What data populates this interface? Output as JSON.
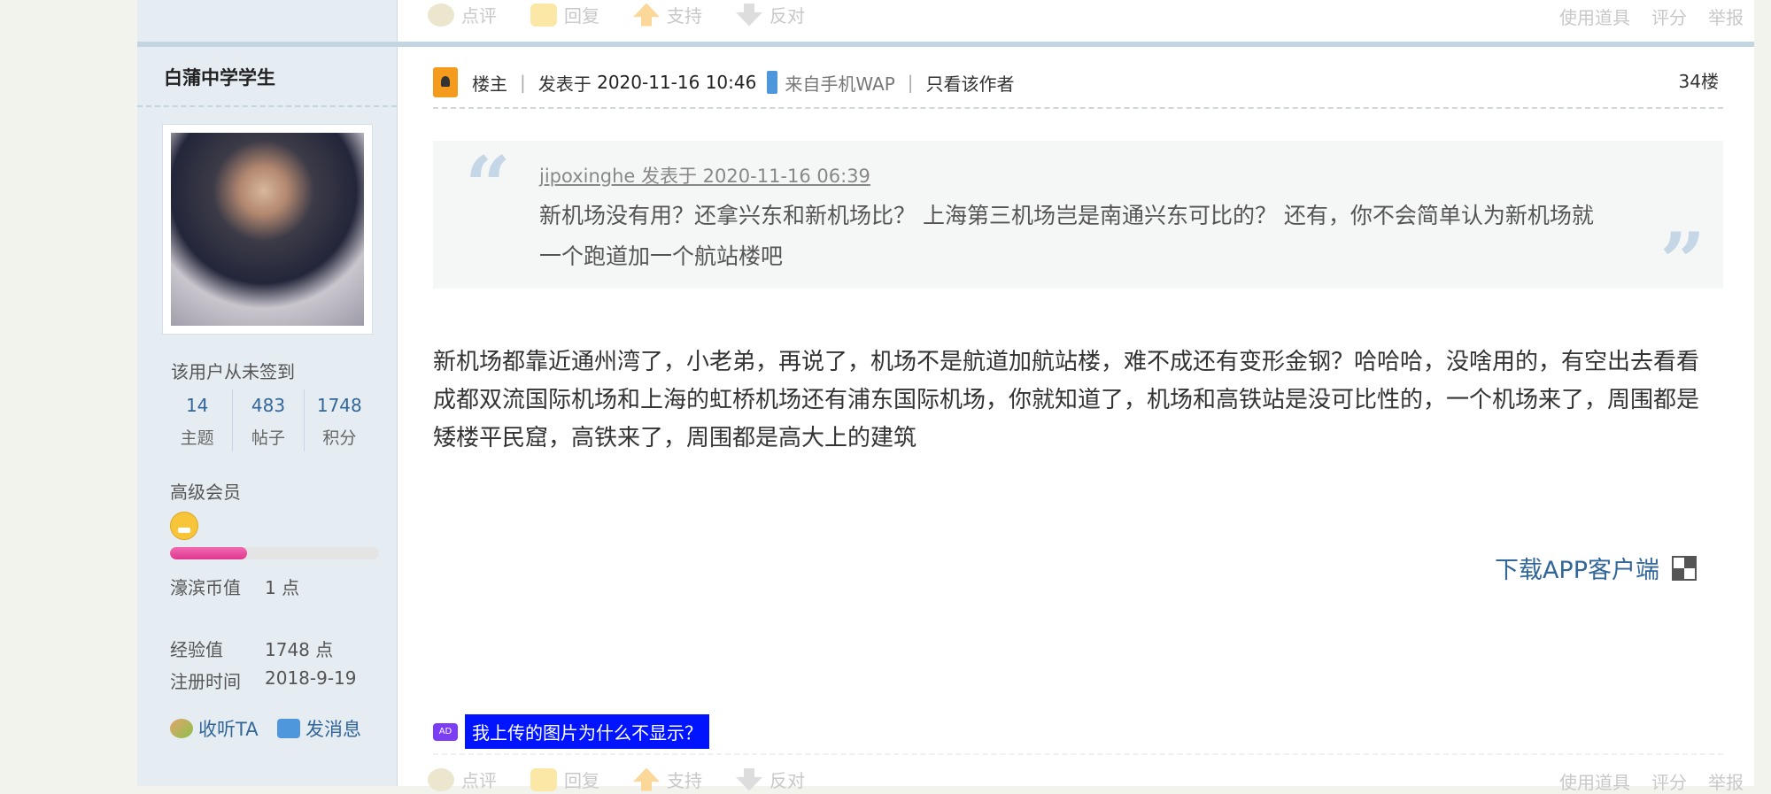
{
  "top_actions": {
    "comment": "点评",
    "reply": "回复",
    "support": "支持",
    "oppose": "反对",
    "tools": "使用道具",
    "rate": "评分",
    "report": "举报"
  },
  "user": {
    "name": "白蒲中学学生",
    "checkin": "该用户从未签到",
    "stats": [
      {
        "num": "14",
        "label": "主题"
      },
      {
        "num": "483",
        "label": "帖子"
      },
      {
        "num": "1748",
        "label": "积分"
      }
    ],
    "level": "高级会员",
    "level_progress": 0.37,
    "coin_label": "濠滨币值",
    "coin_value": "1 点",
    "exp_label": "经验值",
    "exp_value": "1748 点",
    "reg_label": "注册时间",
    "reg_value": "2018-9-19",
    "follow": "收听TA",
    "message": "发消息"
  },
  "post": {
    "owner": "楼主",
    "posted_prefix": "发表于",
    "posted_time": "2020-11-16 10:46",
    "source": "来自手机WAP",
    "only_author": "只看该作者",
    "floor": "34楼",
    "quote_header": "jipoxinghe 发表于 2020-11-16 06:39",
    "quote_body": "新机场没有用？还拿兴东和新机场比？ 上海第三机场岂是南通兴东可比的？ 还有，你不会简单认为新机场就一个跑道加一个航站楼吧",
    "content": "新机场都靠近通州湾了，小老弟，再说了，机场不是航道加航站楼，难不成还有变形金钢？哈哈哈，没啥用的，有空出去看看成都双流国际机场和上海的虹桥机场还有浦东国际机场，你就知道了，机场和高铁站是没可比性的，一个机场来了，周围都是矮楼平民窟，高铁来了，周围都是高大上的建筑",
    "download": "下载APP客户端",
    "ad_icon": "AD",
    "ad_text": "我上传的图片为什么不显示？"
  }
}
